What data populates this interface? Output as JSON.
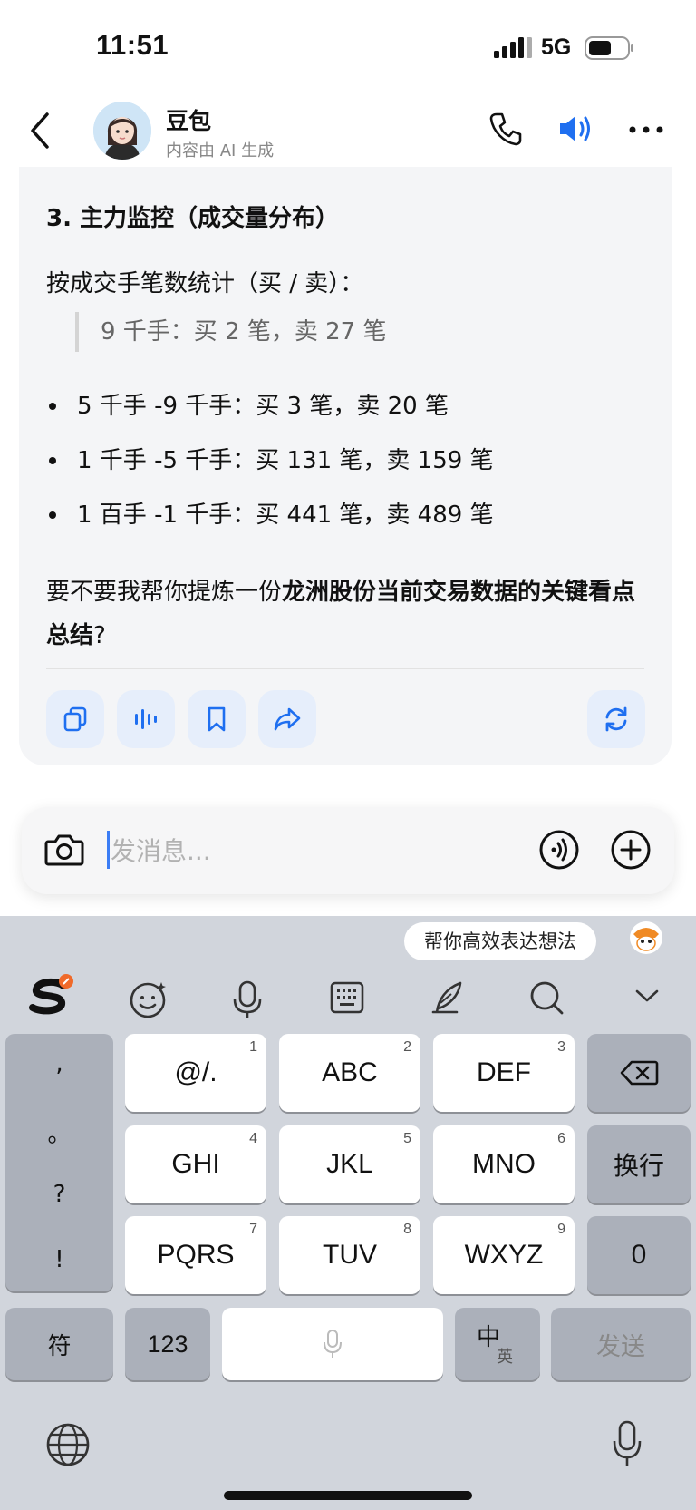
{
  "status_bar": {
    "time": "11:51",
    "network": "5G"
  },
  "header": {
    "title": "豆包",
    "subtitle": "内容由 AI 生成"
  },
  "message": {
    "heading": "3. 主力监控（成交量分布）",
    "intro": "按成交手笔数统计（买 / 卖）：",
    "quote": "9 千手：买 2 笔，卖 27 笔",
    "bullets": [
      "5 千手 -9 千手：买 3 笔，卖 20 笔",
      "1 千手 -5 千手：买 131 笔，卖 159 笔",
      "1 百手 -1 千手：买 441 笔，卖 489 笔"
    ],
    "question_prefix": "要不要我帮你提炼一份",
    "question_bold": "龙洲股份当前交易数据的关键看点总结",
    "question_suffix": "?"
  },
  "actions": [
    "copy-icon",
    "voice-wave-icon",
    "bookmark-icon",
    "share-icon",
    "regenerate-icon"
  ],
  "composer": {
    "placeholder": "发消息..."
  },
  "keyboard": {
    "suggestion": "帮你高效表达想法",
    "punctuation": [
      ",",
      "。",
      "?",
      "!"
    ],
    "keys": [
      {
        "label": "@/.",
        "num": "1"
      },
      {
        "label": "ABC",
        "num": "2"
      },
      {
        "label": "DEF",
        "num": "3"
      },
      {
        "label": "GHI",
        "num": "4"
      },
      {
        "label": "JKL",
        "num": "5"
      },
      {
        "label": "MNO",
        "num": "6"
      },
      {
        "label": "PQRS",
        "num": "7"
      },
      {
        "label": "TUV",
        "num": "8"
      },
      {
        "label": "WXYZ",
        "num": "9"
      }
    ],
    "newline": "换行",
    "zero": "0",
    "symbols": "符",
    "numbers": "123",
    "lang_main": "中",
    "lang_alt": "英",
    "send": "发送"
  },
  "colors": {
    "accent": "#1f6ff0",
    "card_bg": "#f4f5f7",
    "keyboard_bg": "#d1d5dc"
  }
}
